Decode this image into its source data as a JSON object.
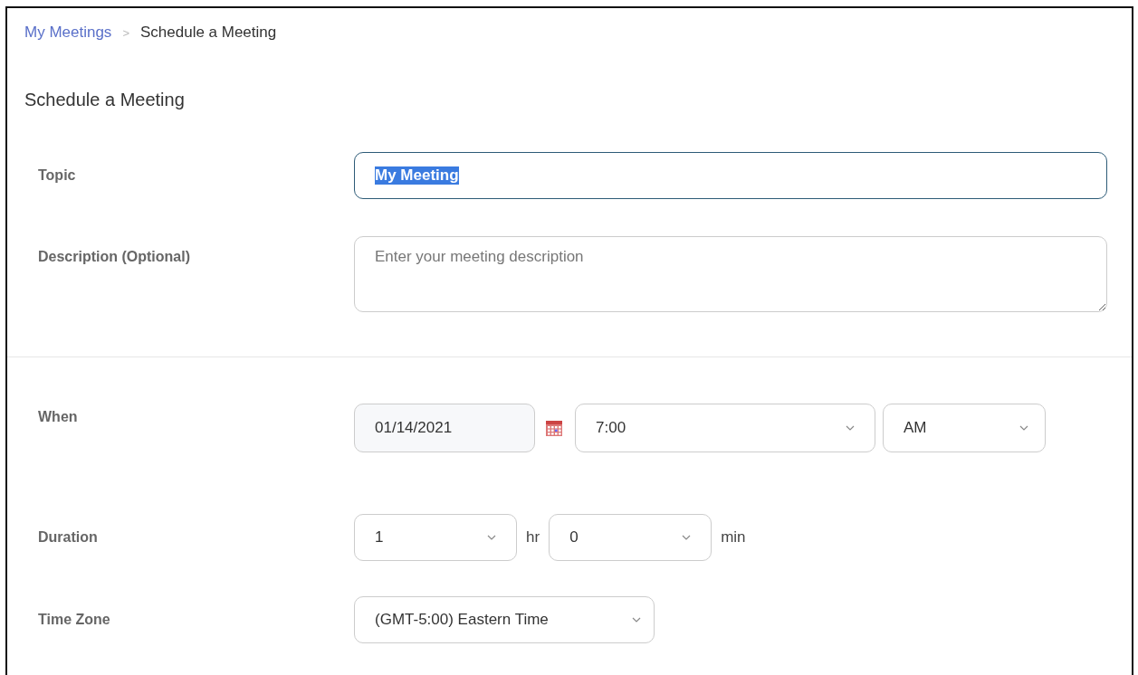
{
  "breadcrumb": {
    "link": "My Meetings",
    "separator": ">",
    "current": "Schedule a Meeting"
  },
  "title": "Schedule a Meeting",
  "topic": {
    "label": "Topic",
    "value": "My Meeting",
    "text_selected": true,
    "focused": true
  },
  "description": {
    "label": "Description (Optional)",
    "placeholder": "Enter your meeting description"
  },
  "when": {
    "label": "When",
    "date": "01/14/2021",
    "time": "7:00",
    "ampm": "AM"
  },
  "duration": {
    "label": "Duration",
    "hours": "1",
    "hours_unit": "hr",
    "minutes": "0",
    "minutes_unit": "min"
  },
  "time_zone": {
    "label": "Time Zone",
    "value": "(GMT-5:00) Eastern Time"
  }
}
